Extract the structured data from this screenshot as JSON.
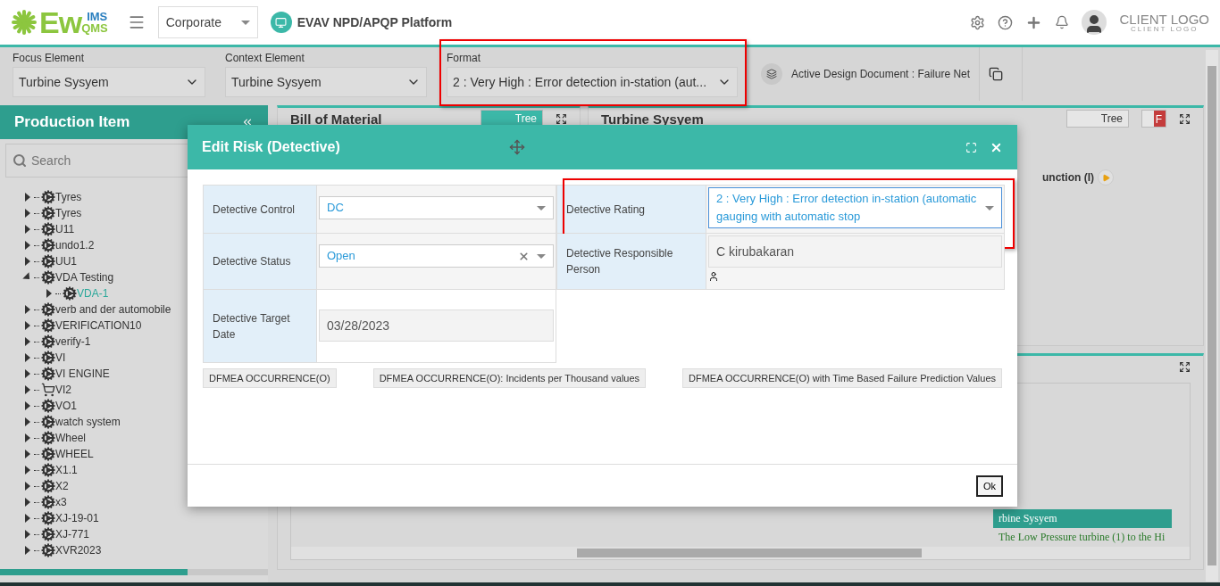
{
  "header": {
    "logo": {
      "main": "Ew",
      "top": "IMS",
      "bottom": "QMS"
    },
    "company": "Corporate",
    "platform": "EVAV NPD/APQP Platform",
    "client_logo": {
      "main": "CLIENT LOGO",
      "sub": "CLIENT LOGO"
    }
  },
  "toolbar": {
    "fields": [
      {
        "label": "Focus Element",
        "value": "Turbine Sysyem",
        "highlighted": false
      },
      {
        "label": "Context Element",
        "value": "Turbine Sysyem",
        "highlighted": false
      },
      {
        "label": "Format",
        "value": "2 : Very High : Error detection in-station (aut...",
        "highlighted": true
      }
    ],
    "active_document": "Active Design Document : Failure Net"
  },
  "sidebar": {
    "title": "Production Item",
    "search": {
      "placeholder": "Search"
    },
    "items": [
      {
        "label": "Tyres",
        "kind": "assembly",
        "expanded": false,
        "selected": false
      },
      {
        "label": "Tyres",
        "kind": "assembly",
        "expanded": false,
        "selected": false
      },
      {
        "label": "U11",
        "kind": "assembly",
        "expanded": false,
        "selected": false
      },
      {
        "label": "undo1.2",
        "kind": "assembly",
        "expanded": false,
        "selected": false
      },
      {
        "label": "UU1",
        "kind": "assembly",
        "expanded": false,
        "selected": false
      },
      {
        "label": "VDA Testing",
        "kind": "assembly",
        "expanded": true,
        "selected": false,
        "children": [
          {
            "label": "VDA-1",
            "kind": "assembly",
            "expanded": false,
            "selected": true
          }
        ]
      },
      {
        "label": "verb and der automobile",
        "kind": "assembly",
        "expanded": false,
        "selected": false
      },
      {
        "label": "VERIFICATION10",
        "kind": "assembly",
        "expanded": false,
        "selected": false
      },
      {
        "label": "verify-1",
        "kind": "assembly",
        "expanded": false,
        "selected": false
      },
      {
        "label": "VI",
        "kind": "assembly",
        "expanded": false,
        "selected": false
      },
      {
        "label": "VI ENGINE",
        "kind": "assembly",
        "expanded": false,
        "selected": false
      },
      {
        "label": "VI2",
        "kind": "cart",
        "expanded": false,
        "selected": false
      },
      {
        "label": "VO1",
        "kind": "assembly",
        "expanded": false,
        "selected": false
      },
      {
        "label": "watch system",
        "kind": "assembly",
        "expanded": false,
        "selected": false
      },
      {
        "label": "Wheel",
        "kind": "assembly",
        "expanded": false,
        "selected": false
      },
      {
        "label": "WHEEL",
        "kind": "assembly",
        "expanded": false,
        "selected": false
      },
      {
        "label": "X1.1",
        "kind": "assembly",
        "expanded": false,
        "selected": false
      },
      {
        "label": "X2",
        "kind": "assembly",
        "expanded": false,
        "selected": false
      },
      {
        "label": "x3",
        "kind": "assembly",
        "expanded": false,
        "selected": false
      },
      {
        "label": "XJ-19-01",
        "kind": "assembly",
        "expanded": false,
        "selected": false
      },
      {
        "label": "XJ-771",
        "kind": "assembly",
        "expanded": false,
        "selected": false
      },
      {
        "label": "XVR2023",
        "kind": "assembly",
        "expanded": false,
        "selected": false
      }
    ]
  },
  "bom_panel": {
    "title": "Bill of Material",
    "toggle": {
      "label": "Tree",
      "on": true
    }
  },
  "detail_panel": {
    "title": "Turbine Sysyem",
    "toggle": {
      "label": "Tree",
      "on": false
    },
    "flag": "F",
    "function_label": "unction (I)",
    "grid": {
      "header": "rbine Sysyem",
      "row": "The Low Pressure turbine (1) to the Hi"
    }
  },
  "dialog": {
    "title": "Edit Risk (Detective)",
    "left_fields": [
      {
        "label": "Detective Control",
        "value": "DC",
        "kind": "select",
        "clearable": false
      },
      {
        "label": "Detective Status",
        "value": "Open",
        "kind": "select",
        "clearable": true
      },
      {
        "label": "Detective Target Date",
        "value": "03/28/2023",
        "kind": "readonly"
      }
    ],
    "right_fields": [
      {
        "label": "Detective Rating",
        "value": "2 : Very High : Error detection in-station (automatic gauging with automatic stop",
        "kind": "select",
        "clearable": false,
        "highlighted": true
      },
      {
        "label": "Detective Responsible Person",
        "value": "C kirubakaran",
        "kind": "person",
        "highlighted": false
      }
    ],
    "reference_buttons": [
      "DFMEA OCCURRENCE(O)",
      "DFMEA OCCURRENCE(O): Incidents per Thousand values",
      "DFMEA OCCURRENCE(O) with Time Based Failure Prediction Values"
    ],
    "ok": "Ok"
  }
}
